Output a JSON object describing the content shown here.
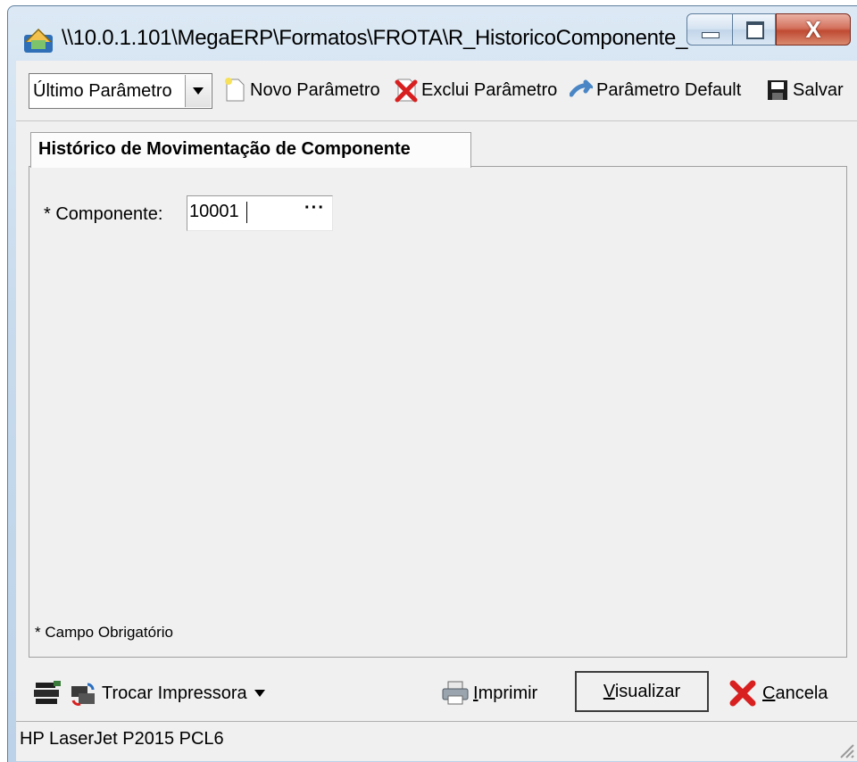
{
  "window": {
    "title": "\\\\10.0.1.101\\MegaERP\\Formatos\\FROTA\\R_HistoricoComponente_...",
    "close_glyph": "X"
  },
  "toolbar": {
    "parameter_select": {
      "value": "Último Parâmetro"
    },
    "new_parameter": "Novo Parâmetro",
    "delete_parameter": "Exclui Parâmetro",
    "default_parameter": "Parâmetro Default",
    "save": "Salvar"
  },
  "tab": {
    "label": "Histórico de Movimentação de Componente"
  },
  "form": {
    "componente_label": "* Componente:",
    "componente_value": "10001",
    "lookup_button": "···",
    "mandatory_note": "* Campo Obrigatório"
  },
  "actions": {
    "change_printer": "Trocar Impressora",
    "print_prefix": "I",
    "print_rest": "mprimir",
    "visualize_prefix": "V",
    "visualize_rest": "isualizar",
    "cancel_prefix": "C",
    "cancel_rest": "ancela"
  },
  "status": {
    "printer": "HP LaserJet P2015 PCL6"
  },
  "icons": {
    "app": "app-icon",
    "minimize": "minimize-icon",
    "maximize": "maximize-icon",
    "close": "close-icon",
    "new": "new-document-icon",
    "delete": "delete-x-icon",
    "default": "default-arrow-icon",
    "save": "floppy-disk-icon",
    "printer_setup": "printer-setup-icon",
    "swap_printer": "swap-printer-icon",
    "print": "printer-icon",
    "cancel": "cancel-x-icon"
  },
  "colors": {
    "delete_red": "#d82020",
    "default_blue": "#4a86c5",
    "close_red": "#c04a33"
  }
}
